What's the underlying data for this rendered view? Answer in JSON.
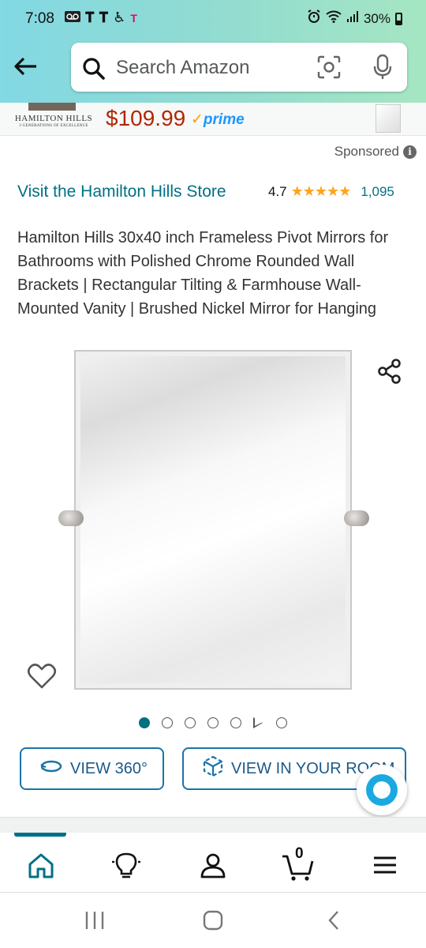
{
  "status_bar": {
    "time": "7:08",
    "carrier_icons": [
      "voicemail-icon",
      "t-mobile-icon",
      "t-mobile-icon",
      "accessibility-icon",
      "t-mobile-small-icon"
    ],
    "right_icons": [
      "alarm-icon",
      "wifi-icon",
      "signal-icon"
    ],
    "battery": "30%"
  },
  "header": {
    "search_placeholder": "Search Amazon"
  },
  "banner_ad": {
    "brand": "HAMILTON HILLS",
    "brand_tagline": "3 GENERATIONS OF EXCELLENCE",
    "price": "$109.99",
    "prime": "prime"
  },
  "sponsored_label": "Sponsored",
  "product": {
    "store_link": "Visit the Hamilton Hills Store",
    "rating": "4.7",
    "stars": "★★★★★",
    "review_count": "1,095",
    "title": "Hamilton Hills 30x40 inch Frameless Pivot Mirrors for Bathrooms with Polished Chrome Rounded Wall Brackets | Rectangular Tilting & Farmhouse Wall-Mounted Vanity | Brushed Nickel Mirror for Hanging"
  },
  "gallery": {
    "dots": 7,
    "active_dot": 1
  },
  "actions": {
    "view360": "VIEW 360°",
    "view_room": "VIEW IN YOUR ROOM"
  },
  "bottom_nav": {
    "cart_count": "0",
    "items": [
      "home-icon",
      "inspire-icon",
      "account-icon",
      "cart-icon",
      "menu-icon"
    ]
  },
  "colors": {
    "link": "#007185",
    "price": "#b12704",
    "star": "#ffa41c",
    "prime": "#1a98ff"
  }
}
